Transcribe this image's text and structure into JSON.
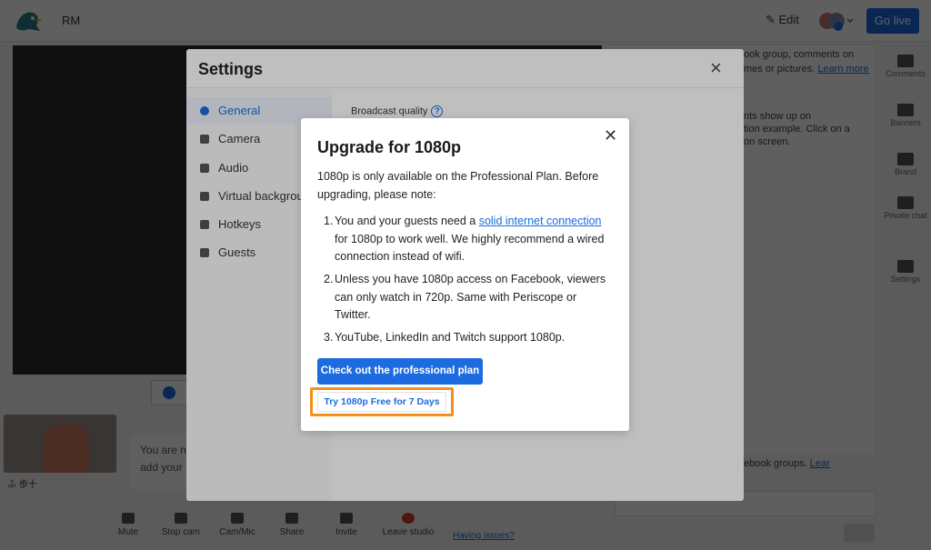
{
  "studio": {
    "name": "RM",
    "edit_label": "Edit",
    "go_live_label": "Go live",
    "right_panel": {
      "line1": "ook group, comments on",
      "line2": "mes or pictures.",
      "line2_link": "Learn more",
      "line3": "nts show up on",
      "line4": "tion example. Click on a",
      "line5": "on screen.",
      "bottom_text": "ebook groups.",
      "bottom_link": "Lear"
    },
    "rail": [
      "Comments",
      "Banners",
      "Brand",
      "Private chat",
      "Settings"
    ],
    "hint_line1": "You are n",
    "hint_line2": "add your",
    "thumb_name": "ふ 歩十",
    "bottom_bar": [
      "Mute",
      "Stop cam",
      "Cam/Mic",
      "Share",
      "Invite",
      "Leave studio"
    ],
    "having_issues": "Having issues?"
  },
  "settings": {
    "title": "Settings",
    "close_icon": "×",
    "nav": [
      {
        "label": "General",
        "icon": "gear-icon"
      },
      {
        "label": "Camera",
        "icon": "camera-icon"
      },
      {
        "label": "Audio",
        "icon": "microphone-icon"
      },
      {
        "label": "Virtual backgrounds",
        "icon": "virtual-background-icon"
      },
      {
        "label": "Hotkeys",
        "icon": "keyboard-icon"
      },
      {
        "label": "Guests",
        "icon": "person-icon"
      }
    ],
    "broadcast_quality_label": "Broadcast quality",
    "help_icon": "?"
  },
  "modal": {
    "title": "Upgrade for 1080p",
    "close_icon": "✕",
    "intro": "1080p is only available on the Professional Plan. Before upgrading, please note:",
    "items": [
      {
        "num": "1.",
        "before": "You and your guests need a ",
        "link": "solid internet connection",
        "after": " for 1080p to work well. We highly recommend a wired connection instead of wifi."
      },
      {
        "num": "2.",
        "text": "Unless you have 1080p access on Facebook, viewers can only watch in 720p. Same with Periscope or Twitter."
      },
      {
        "num": "3.",
        "text": "YouTube, LinkedIn and Twitch support 1080p."
      }
    ],
    "primary_button": "Check out the professional plan",
    "trial_button": "Try 1080p Free for 7 Days"
  },
  "colors": {
    "accent": "#1c6be0",
    "highlight": "#f5901e"
  }
}
